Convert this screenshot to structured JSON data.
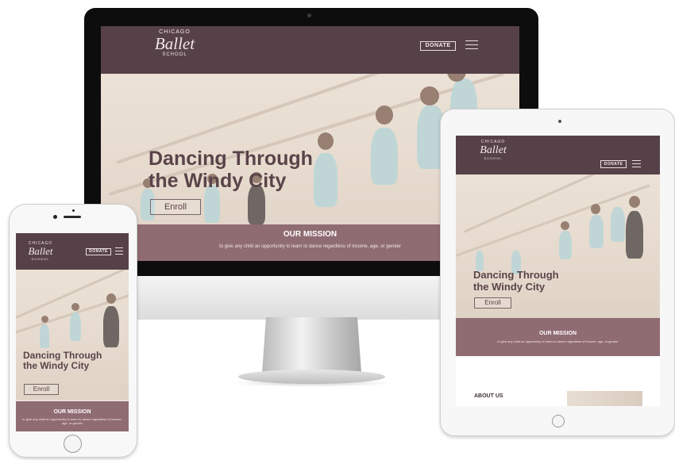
{
  "site": {
    "logo_top": "CHICAGO",
    "logo_main": "Ballet",
    "logo_bottom": "SCHOOL",
    "donate_label": "DONATE",
    "hero_title_line1": "Dancing Through",
    "hero_title_line2": "the Windy City",
    "enroll_label": "Enroll",
    "mission_title": "OUR MISSION",
    "mission_text": "to give any child an opportunity to learn to dance regardless of income, age, or gender",
    "about_title": "ABOUT US"
  },
  "colors": {
    "header_bg": "#574148",
    "mission_bg": "#8f6b72",
    "hero_text": "#5a4349"
  },
  "icons": {
    "menu": "hamburger-icon",
    "home": "home-button-icon",
    "camera": "camera-icon"
  }
}
